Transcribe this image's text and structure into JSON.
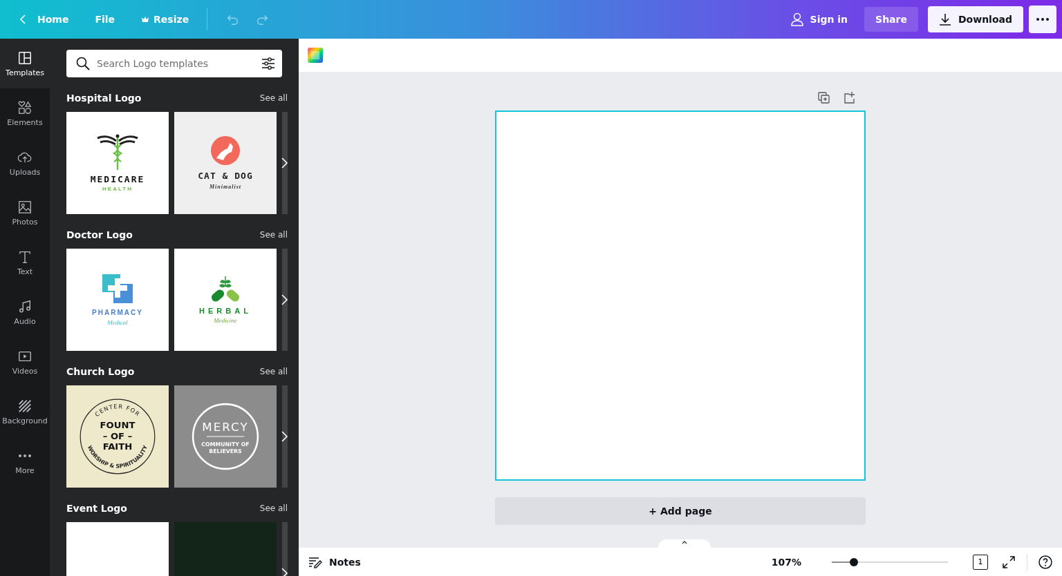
{
  "topbar": {
    "home": "Home",
    "file": "File",
    "resize": "Resize",
    "sign_in": "Sign in",
    "share": "Share",
    "download": "Download"
  },
  "rail": [
    {
      "label": "Templates",
      "kind": "templates",
      "selected": true
    },
    {
      "label": "Elements",
      "kind": "elements",
      "selected": false
    },
    {
      "label": "Uploads",
      "kind": "uploads",
      "selected": false
    },
    {
      "label": "Photos",
      "kind": "photos",
      "selected": false
    },
    {
      "label": "Text",
      "kind": "text",
      "selected": false
    },
    {
      "label": "Audio",
      "kind": "audio",
      "selected": false
    },
    {
      "label": "Videos",
      "kind": "videos",
      "selected": false
    },
    {
      "label": "Background",
      "kind": "background",
      "selected": false
    },
    {
      "label": "More",
      "kind": "more",
      "selected": false
    }
  ],
  "search": {
    "placeholder": "Search Logo templates"
  },
  "sections": [
    {
      "title": "Hospital Logo",
      "see_all": "See all",
      "cards": [
        {
          "kind": "medicare",
          "texts": [
            "MEDICARE",
            "HEALTH"
          ]
        },
        {
          "kind": "catdog",
          "texts": [
            "CAT & DOG",
            "Minimalist"
          ]
        }
      ]
    },
    {
      "title": "Doctor Logo",
      "see_all": "See all",
      "cards": [
        {
          "kind": "pharmacy",
          "texts": [
            "PHARMACY",
            "Medical"
          ]
        },
        {
          "kind": "herbal",
          "texts": [
            "HERBAL",
            "Medicine"
          ]
        }
      ]
    },
    {
      "title": "Church Logo",
      "see_all": "See all",
      "cards": [
        {
          "kind": "seal",
          "texts": [
            "CENTER FOR",
            "FOUNT",
            "– OF –",
            "FAITH",
            "WORSHIP & SPIRITUALITY"
          ]
        },
        {
          "kind": "mercy",
          "texts": [
            "MERCY",
            "COMMUNITY OF",
            "BELIEVERS"
          ]
        }
      ]
    },
    {
      "title": "Event Logo",
      "see_all": "See all",
      "cards": [
        {
          "kind": "blank"
        },
        {
          "kind": "dark"
        }
      ]
    }
  ],
  "canvas": {
    "add_page": "+ Add page"
  },
  "bottom": {
    "notes": "Notes",
    "zoom": "107%",
    "level": 0.19,
    "pages": "1"
  }
}
